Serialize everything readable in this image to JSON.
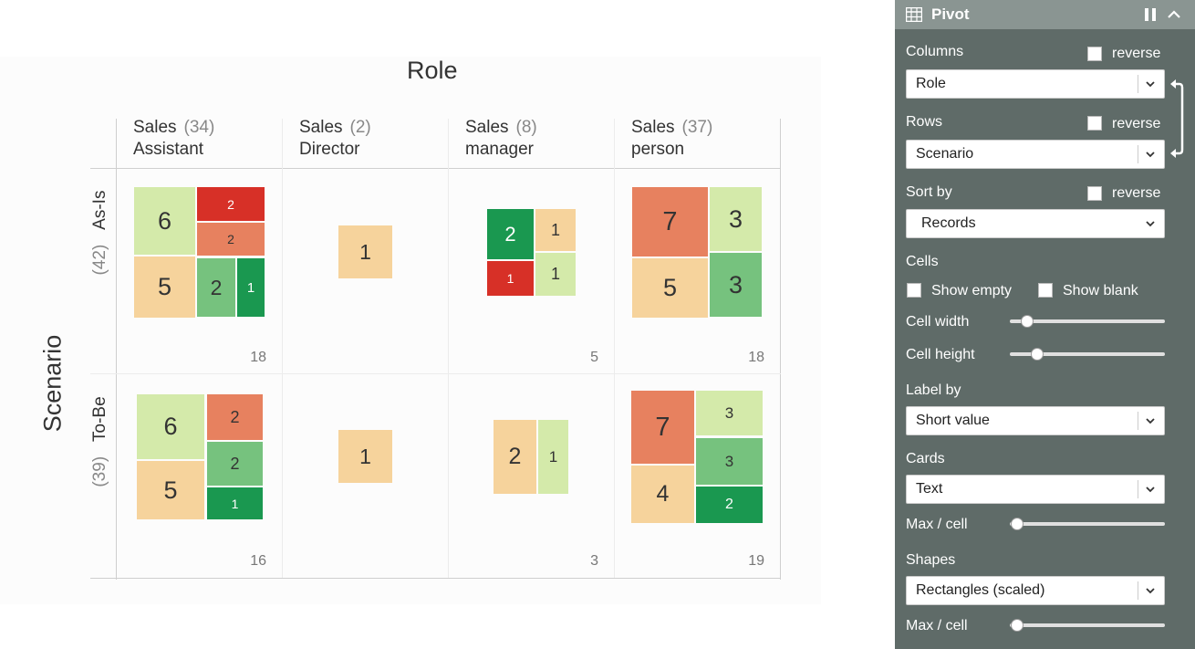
{
  "matrix": {
    "column_title": "Role",
    "row_title": "Scenario",
    "columns": [
      {
        "label_line1": "Sales",
        "label_line2": "Assistant",
        "count": "(34)"
      },
      {
        "label_line1": "Sales",
        "label_line2": "Director",
        "count": "(2)"
      },
      {
        "label_line1": "Sales",
        "label_line2": "manager",
        "count": "(8)"
      },
      {
        "label_line1": "Sales",
        "label_line2": "person",
        "count": "(37)"
      }
    ],
    "rows": [
      {
        "label": "As-Is",
        "count": "(42)"
      },
      {
        "label": "To-Be",
        "count": "(39)"
      }
    ],
    "cell_totals": {
      "r0c0": "18",
      "r0c2": "5",
      "r0c3": "18",
      "r1c0": "16",
      "r1c2": "3",
      "r1c3": "19"
    },
    "cards": {
      "r0c0": [
        "6",
        "2",
        "2",
        "5",
        "2",
        "1"
      ],
      "r0c1": [
        "1"
      ],
      "r0c2": [
        "2",
        "1",
        "1",
        "1"
      ],
      "r0c3": [
        "7",
        "3",
        "5",
        "3"
      ],
      "r1c0": [
        "6",
        "2",
        "2",
        "5",
        "1"
      ],
      "r1c1": [
        "1"
      ],
      "r1c2": [
        "2",
        "1"
      ],
      "r1c3": [
        "7",
        "3",
        "3",
        "4",
        "2"
      ]
    },
    "colors": {
      "light_green": "#d4eaaa",
      "mid_green": "#76c27e",
      "dark_green": "#1a9850",
      "peach": "#f6d39c",
      "salmon": "#e7815f",
      "red": "#d73027"
    }
  },
  "sidebar": {
    "title": "Pivot",
    "icons": {
      "grid": "table-icon",
      "columns": "columns-icon",
      "collapse": "chevron-up-icon"
    },
    "columns_label": "Columns",
    "columns_value": "Role",
    "rows_label": "Rows",
    "rows_value": "Scenario",
    "sort_label": "Sort by",
    "sort_value": "Records",
    "reverse_label": "reverse",
    "cells_label": "Cells",
    "show_empty": "Show empty",
    "show_blank": "Show blank",
    "cell_width_label": "Cell width",
    "cell_height_label": "Cell height",
    "label_by_label": "Label by",
    "label_by_value": "Short value",
    "cards_label": "Cards",
    "cards_value": "Text",
    "max_cell_label": "Max / cell",
    "shapes_label": "Shapes",
    "shapes_value": "Rectangles (scaled)",
    "max_cell_label_2": "Max / cell"
  }
}
